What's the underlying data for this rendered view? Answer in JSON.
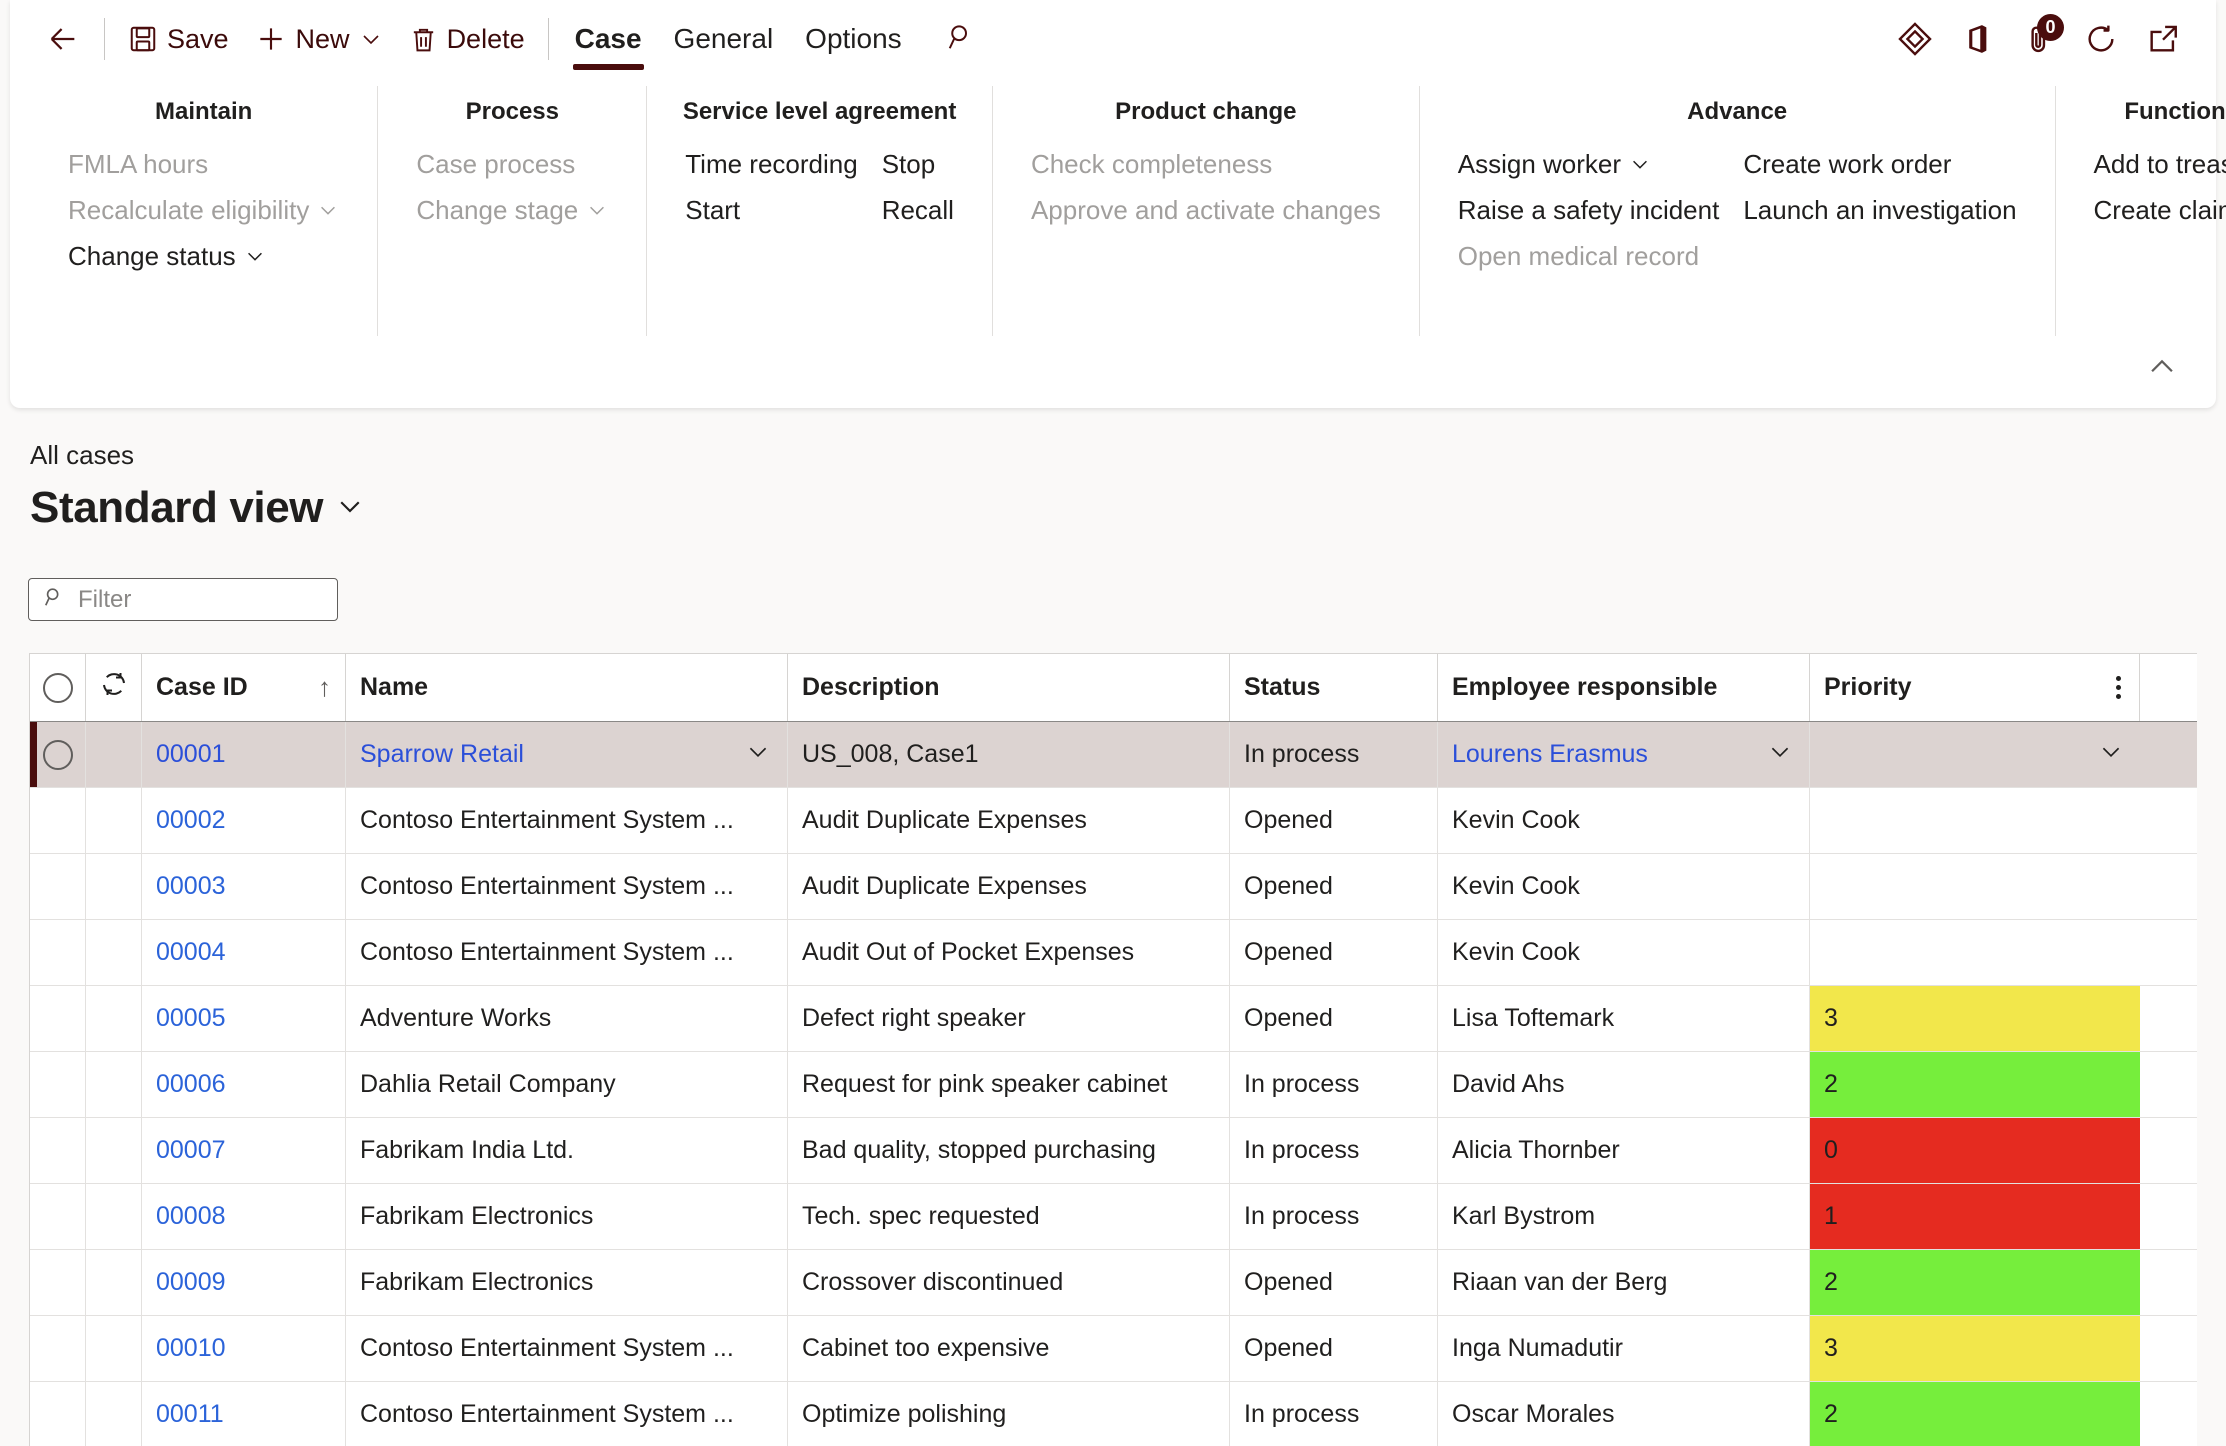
{
  "commandbar": {
    "back_label": "",
    "save_label": "Save",
    "new_label": "New",
    "delete_label": "Delete",
    "tabs": [
      {
        "label": "Case",
        "active": true
      },
      {
        "label": "General",
        "active": false
      },
      {
        "label": "Options",
        "active": false
      }
    ],
    "search_icon": "search-icon",
    "right_icons": [
      {
        "name": "power-bi-icon",
        "badge": null
      },
      {
        "name": "office-icon",
        "badge": null
      },
      {
        "name": "attachment-icon",
        "badge": "0"
      },
      {
        "name": "refresh-icon",
        "badge": null
      },
      {
        "name": "open-in-new-window-icon",
        "badge": null
      }
    ]
  },
  "action_groups": [
    {
      "title": "Maintain",
      "columns": [
        [
          {
            "label": "FMLA hours",
            "disabled": true,
            "chevron": false
          },
          {
            "label": "Recalculate eligibility",
            "disabled": true,
            "chevron": true
          },
          {
            "label": "Change status",
            "disabled": false,
            "chevron": true
          }
        ]
      ]
    },
    {
      "title": "Process",
      "columns": [
        [
          {
            "label": "Case process",
            "disabled": true,
            "chevron": false
          },
          {
            "label": "Change stage",
            "disabled": true,
            "chevron": true
          }
        ]
      ]
    },
    {
      "title": "Service level agreement",
      "columns": [
        [
          {
            "label": "Time recording",
            "disabled": false,
            "chevron": false
          },
          {
            "label": "Start",
            "disabled": false,
            "chevron": false
          }
        ],
        [
          {
            "label": "Stop",
            "disabled": false,
            "chevron": false
          },
          {
            "label": "Recall",
            "disabled": false,
            "chevron": false
          }
        ]
      ]
    },
    {
      "title": "Product change",
      "columns": [
        [
          {
            "label": "Check completeness",
            "disabled": true,
            "chevron": false
          },
          {
            "label": "Approve and activate changes",
            "disabled": true,
            "chevron": false
          }
        ]
      ]
    },
    {
      "title": "Advance",
      "columns": [
        [
          {
            "label": "Assign worker",
            "disabled": false,
            "chevron": true
          },
          {
            "label": "Raise a safety incident",
            "disabled": false,
            "chevron": false
          },
          {
            "label": "Open medical record",
            "disabled": true,
            "chevron": false
          }
        ],
        [
          {
            "label": "Create work order",
            "disabled": false,
            "chevron": false
          },
          {
            "label": "Launch an investigation",
            "disabled": false,
            "chevron": false
          }
        ]
      ]
    },
    {
      "title": "Functions",
      "columns": [
        [
          {
            "label": "Add to treasury",
            "disabled": false,
            "chevron": false
          },
          {
            "label": "Create claim",
            "disabled": false,
            "chevron": false
          }
        ]
      ]
    }
  ],
  "collapse_button": "collapse-action-pane",
  "page": {
    "breadcrumb": "All cases",
    "view_title": "Standard view"
  },
  "filter": {
    "placeholder": "Filter",
    "value": ""
  },
  "grid": {
    "columns": [
      {
        "key": "caseid",
        "label": "Case ID",
        "sort": "↑"
      },
      {
        "key": "name",
        "label": "Name",
        "sort": ""
      },
      {
        "key": "desc",
        "label": "Description",
        "sort": ""
      },
      {
        "key": "status",
        "label": "Status",
        "sort": ""
      },
      {
        "key": "emp",
        "label": "Employee responsible",
        "sort": ""
      },
      {
        "key": "prio",
        "label": "Priority",
        "sort": ""
      }
    ],
    "priority_colors": {
      "0": "#e52b20",
      "1": "#e52b20",
      "2": "#76ee3c",
      "3": "#f2e74b"
    },
    "rows": [
      {
        "caseid": "00001",
        "name": "Sparrow Retail",
        "desc": "US_008, Case1",
        "status": "In process",
        "emp": "Lourens Erasmus",
        "prio": "",
        "selected": true,
        "caseid_link": true,
        "name_link": true,
        "emp_link": true
      },
      {
        "caseid": "00002",
        "name": "Contoso Entertainment System ...",
        "desc": "Audit Duplicate Expenses",
        "status": "Opened",
        "emp": "Kevin Cook",
        "prio": "",
        "selected": false,
        "caseid_link": true,
        "name_link": false,
        "emp_link": false
      },
      {
        "caseid": "00003",
        "name": "Contoso Entertainment System ...",
        "desc": "Audit Duplicate Expenses",
        "status": "Opened",
        "emp": "Kevin Cook",
        "prio": "",
        "selected": false,
        "caseid_link": true,
        "name_link": false,
        "emp_link": false
      },
      {
        "caseid": "00004",
        "name": "Contoso Entertainment System ...",
        "desc": "Audit Out of Pocket Expenses",
        "status": "Opened",
        "emp": "Kevin Cook",
        "prio": "",
        "selected": false,
        "caseid_link": true,
        "name_link": false,
        "emp_link": false
      },
      {
        "caseid": "00005",
        "name": "Adventure Works",
        "desc": "Defect right speaker",
        "status": "Opened",
        "emp": "Lisa Toftemark",
        "prio": "3",
        "selected": false,
        "caseid_link": true,
        "name_link": false,
        "emp_link": false
      },
      {
        "caseid": "00006",
        "name": "Dahlia Retail Company",
        "desc": "Request for pink speaker cabinet",
        "status": "In process",
        "emp": "David Ahs",
        "prio": "2",
        "selected": false,
        "caseid_link": true,
        "name_link": false,
        "emp_link": false
      },
      {
        "caseid": "00007",
        "name": "Fabrikam India Ltd.",
        "desc": "Bad quality, stopped purchasing",
        "status": "In process",
        "emp": "Alicia Thornber",
        "prio": "0",
        "selected": false,
        "caseid_link": true,
        "name_link": false,
        "emp_link": false
      },
      {
        "caseid": "00008",
        "name": "Fabrikam Electronics",
        "desc": "Tech. spec requested",
        "status": "In process",
        "emp": "Karl Bystrom",
        "prio": "1",
        "selected": false,
        "caseid_link": true,
        "name_link": false,
        "emp_link": false
      },
      {
        "caseid": "00009",
        "name": "Fabrikam Electronics",
        "desc": "Crossover discontinued",
        "status": "Opened",
        "emp": "Riaan van der Berg",
        "prio": "2",
        "selected": false,
        "caseid_link": true,
        "name_link": false,
        "emp_link": false
      },
      {
        "caseid": "00010",
        "name": "Contoso Entertainment System ...",
        "desc": "Cabinet too expensive",
        "status": "Opened",
        "emp": "Inga Numadutir",
        "prio": "3",
        "selected": false,
        "caseid_link": true,
        "name_link": false,
        "emp_link": false
      },
      {
        "caseid": "00011",
        "name": "Contoso Entertainment System ...",
        "desc": "Optimize polishing",
        "status": "In process",
        "emp": "Oscar Morales",
        "prio": "2",
        "selected": false,
        "caseid_link": true,
        "name_link": false,
        "emp_link": false
      }
    ]
  },
  "theme": {
    "accent": "#4a0d0d",
    "link": "#2b63d9",
    "selected_row_bg": "#dcd3d1",
    "page_bg": "#faf9f8"
  }
}
